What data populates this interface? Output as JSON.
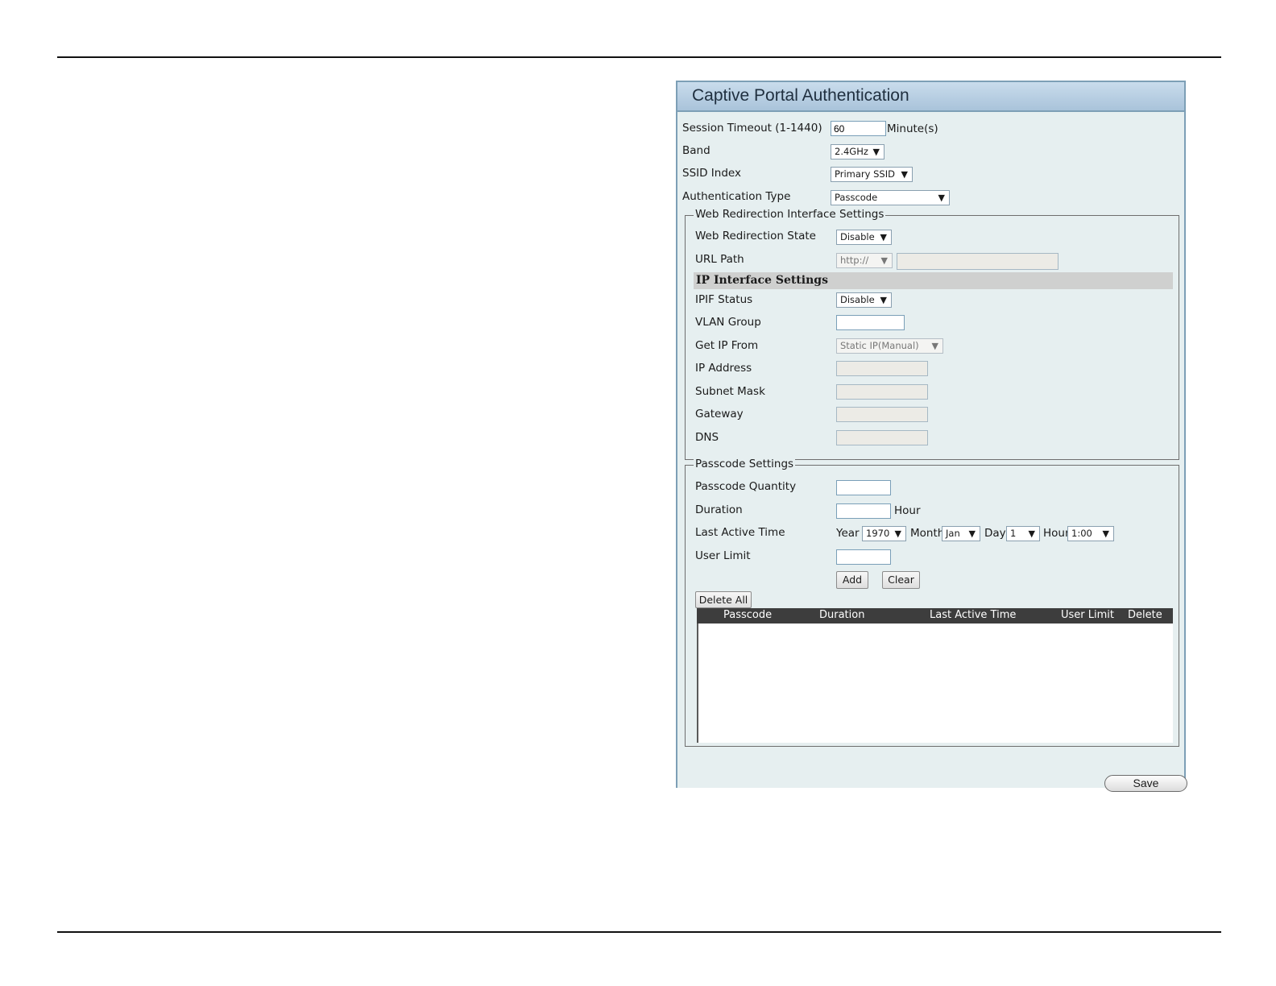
{
  "panel": {
    "title": "Captive Portal Authentication",
    "session_timeout": {
      "label": "Session Timeout (1-1440)",
      "value": "60",
      "unit": "Minute(s)"
    },
    "band": {
      "label": "Band",
      "selected": "2.4GHz"
    },
    "ssid_index": {
      "label": "SSID Index",
      "selected": "Primary SSID"
    },
    "auth_type": {
      "label": "Authentication Type",
      "selected": "Passcode"
    }
  },
  "web_redirection": {
    "legend": "Web Redirection Interface Settings",
    "state": {
      "label": "Web Redirection State",
      "selected": "Disable"
    },
    "url_path": {
      "label": "URL Path",
      "protocol": "http://",
      "value": ""
    }
  },
  "ip_interface": {
    "header": "IP Interface Settings",
    "ipif_status": {
      "label": "IPIF Status",
      "selected": "Disable"
    },
    "vlan_group": {
      "label": "VLAN Group",
      "value": ""
    },
    "get_ip_from": {
      "label": "Get IP From",
      "selected": "Static IP(Manual)"
    },
    "ip_address": {
      "label": "IP Address",
      "value": ""
    },
    "subnet_mask": {
      "label": "Subnet Mask",
      "value": ""
    },
    "gateway": {
      "label": "Gateway",
      "value": ""
    },
    "dns": {
      "label": "DNS",
      "value": ""
    }
  },
  "passcode": {
    "legend": "Passcode Settings",
    "quantity": {
      "label": "Passcode Quantity",
      "value": ""
    },
    "duration": {
      "label": "Duration",
      "value": "",
      "unit": "Hour"
    },
    "last_active": {
      "label": "Last Active Time",
      "year_label": "Year",
      "year": "1970",
      "month_label": "Month",
      "month": "Jan",
      "day_label": "Day",
      "day": "1",
      "hour_label": "Hour",
      "hour": "1:00"
    },
    "user_limit": {
      "label": "User Limit",
      "value": ""
    },
    "add_label": "Add",
    "clear_label": "Clear",
    "delete_all_label": "Delete All",
    "table": {
      "columns": [
        "Passcode",
        "Duration",
        "Last Active Time",
        "User Limit",
        "Delete"
      ],
      "rows": []
    }
  },
  "save_label": "Save"
}
